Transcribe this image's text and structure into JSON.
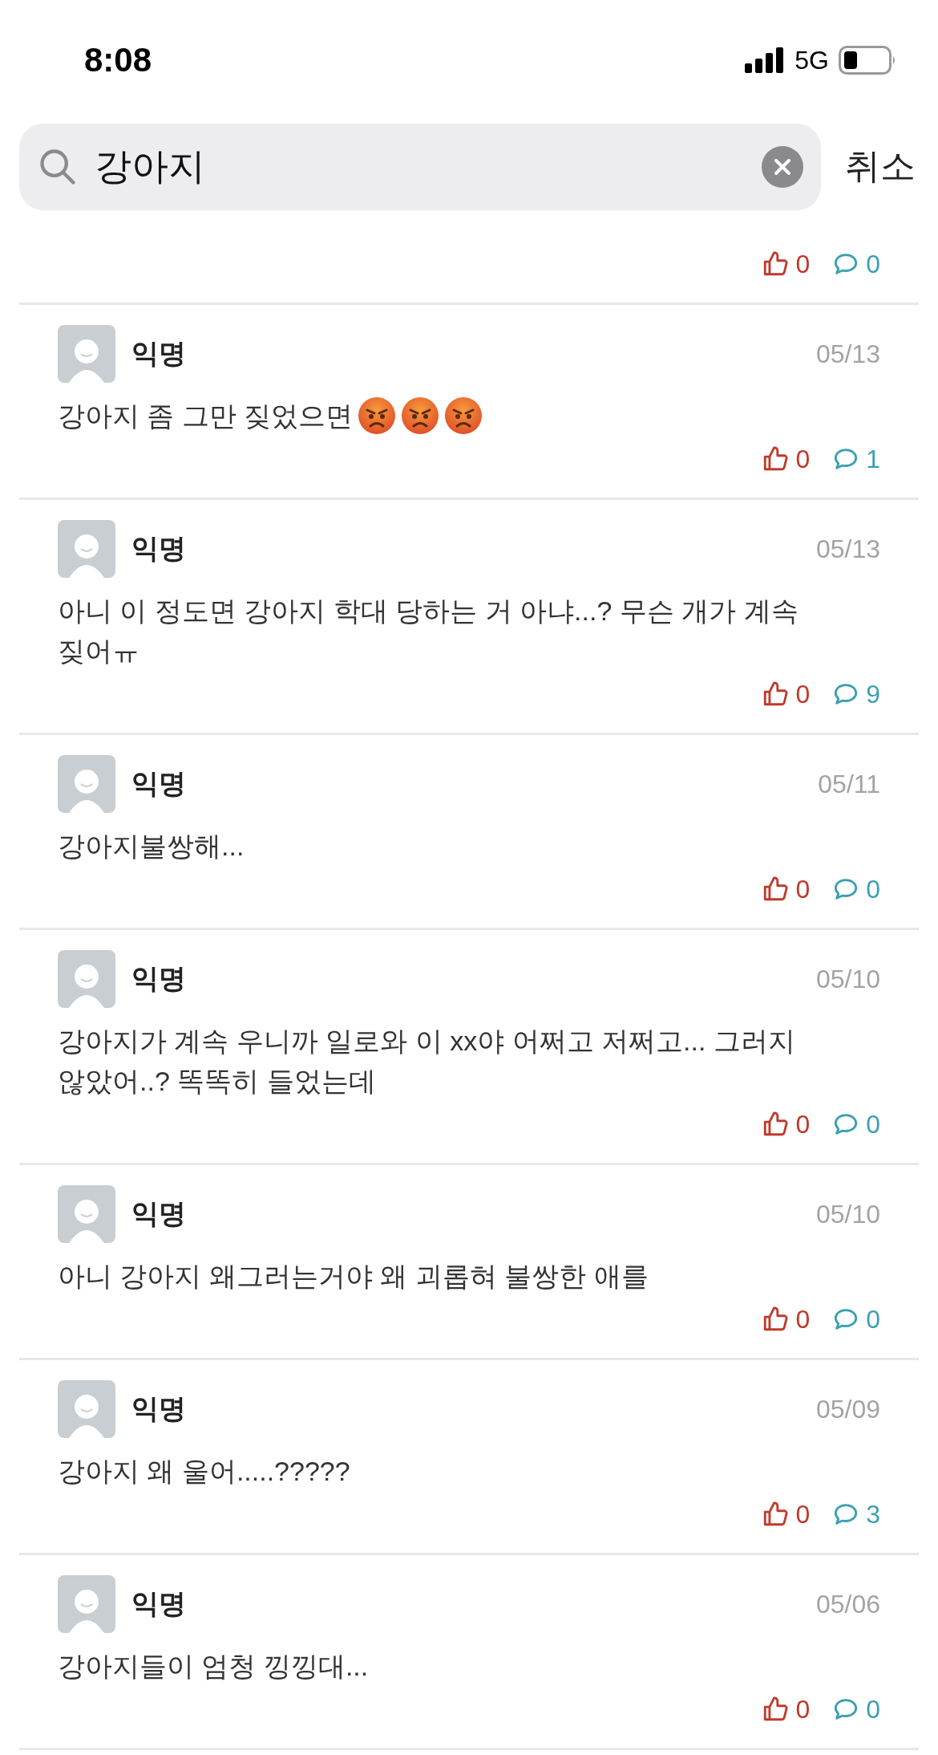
{
  "status_bar": {
    "time": "8:08",
    "network": "5G"
  },
  "search": {
    "value": "강아지",
    "cancel": "취소"
  },
  "partial_post": {
    "likes": "0",
    "comments": "0"
  },
  "posts": [
    {
      "author": "익명",
      "date": "05/13",
      "body": "강아지 좀 그만 짖었으면",
      "emojis": [
        {
          "kind": "angry"
        },
        {
          "kind": "angry"
        },
        {
          "kind": "angry"
        }
      ],
      "likes": "0",
      "comments": "1"
    },
    {
      "author": "익명",
      "date": "05/13",
      "body": "아니 이 정도면 강아지 학대 당하는 거 아냐...? 무슨 개가 계속 짖어ㅠ",
      "likes": "0",
      "comments": "9"
    },
    {
      "author": "익명",
      "date": "05/11",
      "body": "강아지불쌍해...",
      "likes": "0",
      "comments": "0"
    },
    {
      "author": "익명",
      "date": "05/10",
      "body": "강아지가 계속 우니까 일로와 이 xx야 어쩌고 저쩌고... 그러지 않았어..? 똑똑히 들었는데",
      "likes": "0",
      "comments": "0"
    },
    {
      "author": "익명",
      "date": "05/10",
      "body": "아니 강아지 왜그러는거야 왜 괴롭혀 불쌍한 애를",
      "likes": "0",
      "comments": "0"
    },
    {
      "author": "익명",
      "date": "05/09",
      "body": "강아지 왜 울어.....?????",
      "likes": "0",
      "comments": "3"
    },
    {
      "author": "익명",
      "date": "05/06",
      "body": "강아지들이 엄청 낑낑대...",
      "likes": "0",
      "comments": "0"
    }
  ]
}
